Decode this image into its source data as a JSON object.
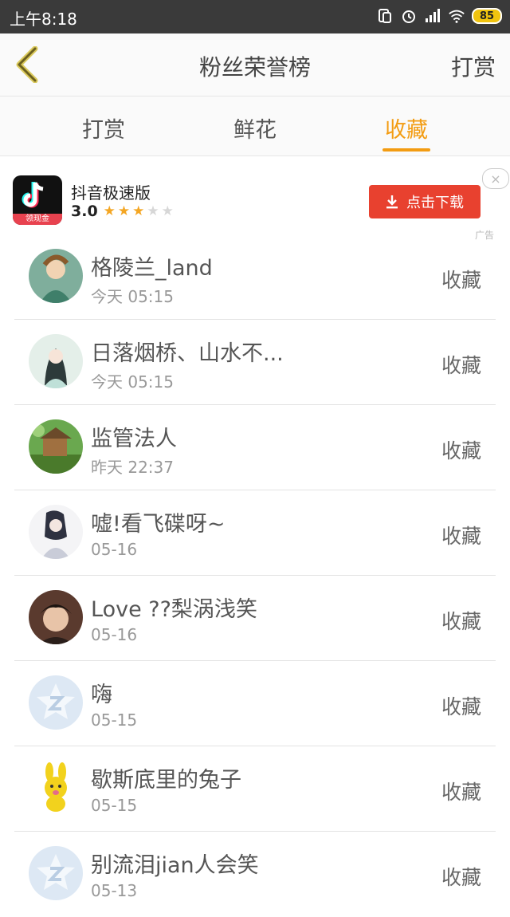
{
  "status": {
    "time": "上午8:18",
    "battery": "85",
    "icons": [
      "sim-icon",
      "alarm-icon",
      "signal-icon",
      "wifi-icon",
      "battery-icon"
    ]
  },
  "header": {
    "back_icon": "chevron-left-icon",
    "title": "粉丝荣誉榜",
    "action": "打赏"
  },
  "tabs": [
    {
      "label": "打赏",
      "active": false
    },
    {
      "label": "鲜花",
      "active": false
    },
    {
      "label": "收藏",
      "active": true
    }
  ],
  "ad": {
    "app_name": "抖音极速版",
    "rating": "3.0",
    "stars_filled": 3,
    "stars_total": 5,
    "icon_badge": "领现金",
    "download_label": "点击下载",
    "close_label": "×",
    "tag": "广告"
  },
  "list": [
    {
      "name": "格陵兰_land",
      "time": "今天 05:15",
      "action": "收藏"
    },
    {
      "name": "日落烟桥、山水不...",
      "time": "今天 05:15",
      "action": "收藏"
    },
    {
      "name": "监管法人",
      "time": "昨天 22:37",
      "action": "收藏"
    },
    {
      "name": "嘘!看飞碟呀~",
      "time": "05-16",
      "action": "收藏"
    },
    {
      "name": "Love ??梨涡浅笑",
      "time": "05-16",
      "action": "收藏"
    },
    {
      "name": "嗨",
      "time": "05-15",
      "action": "收藏"
    },
    {
      "name": "歇斯底里的兔子",
      "time": "05-15",
      "action": "收藏"
    },
    {
      "name": "别流泪jian人会笑",
      "time": "05-13",
      "action": "收藏"
    }
  ],
  "colors": {
    "accent": "#f39c12",
    "download": "#e8412f",
    "status_bar": "#3a3a3a"
  }
}
